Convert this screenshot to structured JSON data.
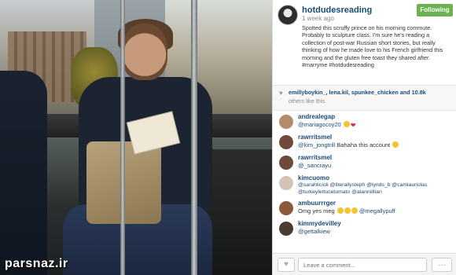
{
  "watermark": "parsnaz.ir",
  "post": {
    "owner": "hotdudesreading",
    "time": "1 week ago",
    "follow_label": "Following",
    "caption": "Spotted this scruffy prince on his morning commute. Probably to sculpture class. I'm sure he's reading a collection of post-war Russian short stories, but really thinking of how he made love to his French girlfriend this morning and the gluten free toast they shared after. #marryme #hotdudesreading"
  },
  "likes": {
    "names": "emillyboykin_, lena.kil, spunkee_chicken and 10.8k",
    "others": "others like this."
  },
  "comments": [
    {
      "user": "andrealegap",
      "mention": "@mariagocoy20",
      "text": "",
      "emoji": [
        "yellow",
        "heart"
      ],
      "avatar_color": "#b58b6a"
    },
    {
      "user": "rawrritsmel",
      "mention": "@kim_jongtrill",
      "text": " Bahaha this account",
      "emoji": [
        "yellow"
      ],
      "avatar_color": "#6e4a3a"
    },
    {
      "user": "rawrritsmel",
      "mention": "@_sancrayu",
      "text": "",
      "emoji": [],
      "avatar_color": "#6e4a3a"
    },
    {
      "user": "kimcuomo",
      "mention": "@sarahlicioli @literallysteph @lynds_b @camiauriolas",
      "text": "",
      "emoji": [],
      "avatar_color": "#d4c3b5",
      "extra": "@turkeylettucetomato @alanniillian"
    },
    {
      "user": "ambuurrrger",
      "mention": "",
      "text": "Omg yes meg",
      "emoji": [
        "yellow",
        "yellow",
        "yellow"
      ],
      "avatar_color": "#8a5a3c",
      "tail": "@megallypuff"
    },
    {
      "user": "kimmydevilley",
      "mention": "@gettalkiew",
      "text": "",
      "emoji": [],
      "avatar_color": "#4b3b33"
    }
  ],
  "footer": {
    "like_icon": "♥",
    "placeholder": "Leave a comment...",
    "more_icon": "…"
  }
}
